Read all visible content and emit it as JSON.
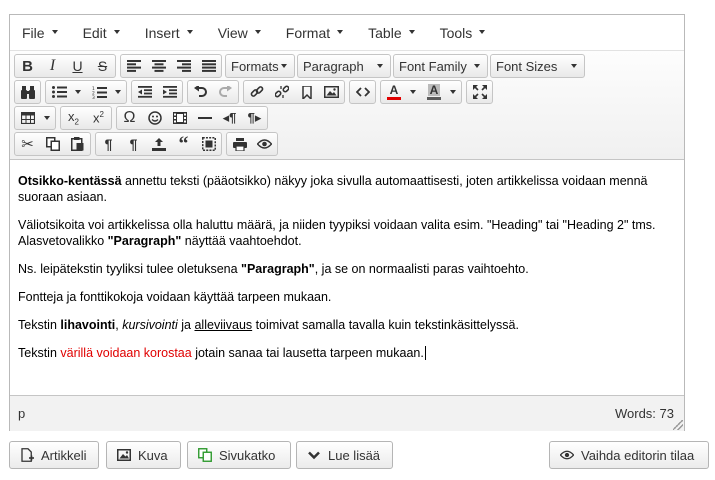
{
  "menubar": {
    "items": [
      "File",
      "Edit",
      "Insert",
      "View",
      "Format",
      "Table",
      "Tools"
    ]
  },
  "toolbar": {
    "formats_label": "Formats",
    "paragraph_label": "Paragraph",
    "font_family_label": "Font Family",
    "font_sizes_label": "Font Sizes",
    "text_color_accent": "#e00000",
    "bg_color_accent": "#5a5a5a"
  },
  "content": {
    "p1": {
      "bold": "Otsikko-kentässä",
      "rest": " annettu teksti (pääotsikko) näkyy joka sivulla automaattisesti, joten artikkelissa voidaan mennä suoraan asiaan."
    },
    "p2": {
      "text1": "Väliotsikoita voi artikkelissa olla haluttu määrä, ja niiden tyypiksi voidaan valita esim. \"Heading\" tai \"Heading 2\" tms. Alasvetovalikko ",
      "bold": "\"Paragraph\"",
      "text2": " näyttää vaahtoehdot."
    },
    "p3": {
      "text1": "Ns. leipätekstin tyyliksi tulee oletuksena ",
      "bold": "\"Paragraph\"",
      "text2": ", ja se on normaalisti paras vaihtoehto."
    },
    "p4": {
      "text": "Fontteja ja fonttikokoja voidaan käyttää tarpeen mukaan."
    },
    "p5": {
      "text1": "Tekstin ",
      "bold": "lihavointi",
      "comma": ", ",
      "italic": "kursivointi",
      "and": " ja ",
      "underline": "alleviivaus",
      "text2": " toimivat samalla tavalla kuin tekstinkäsittelyssä."
    },
    "p6": {
      "text1": "Tekstin ",
      "red": "värillä voidaan korostaa",
      "text2": " jotain sanaa tai lausetta tarpeen mukaan."
    }
  },
  "statusbar": {
    "path": "p",
    "word_count": "Words: 73"
  },
  "buttons": {
    "artikkeli": "Artikkeli",
    "kuva": "Kuva",
    "sivukatko": "Sivukatko",
    "lue_lisaa": "Lue lisää",
    "vaihda": "Vaihda editorin tilaa"
  },
  "colors": {
    "sivukatko_icon": "#2e9a2e"
  }
}
